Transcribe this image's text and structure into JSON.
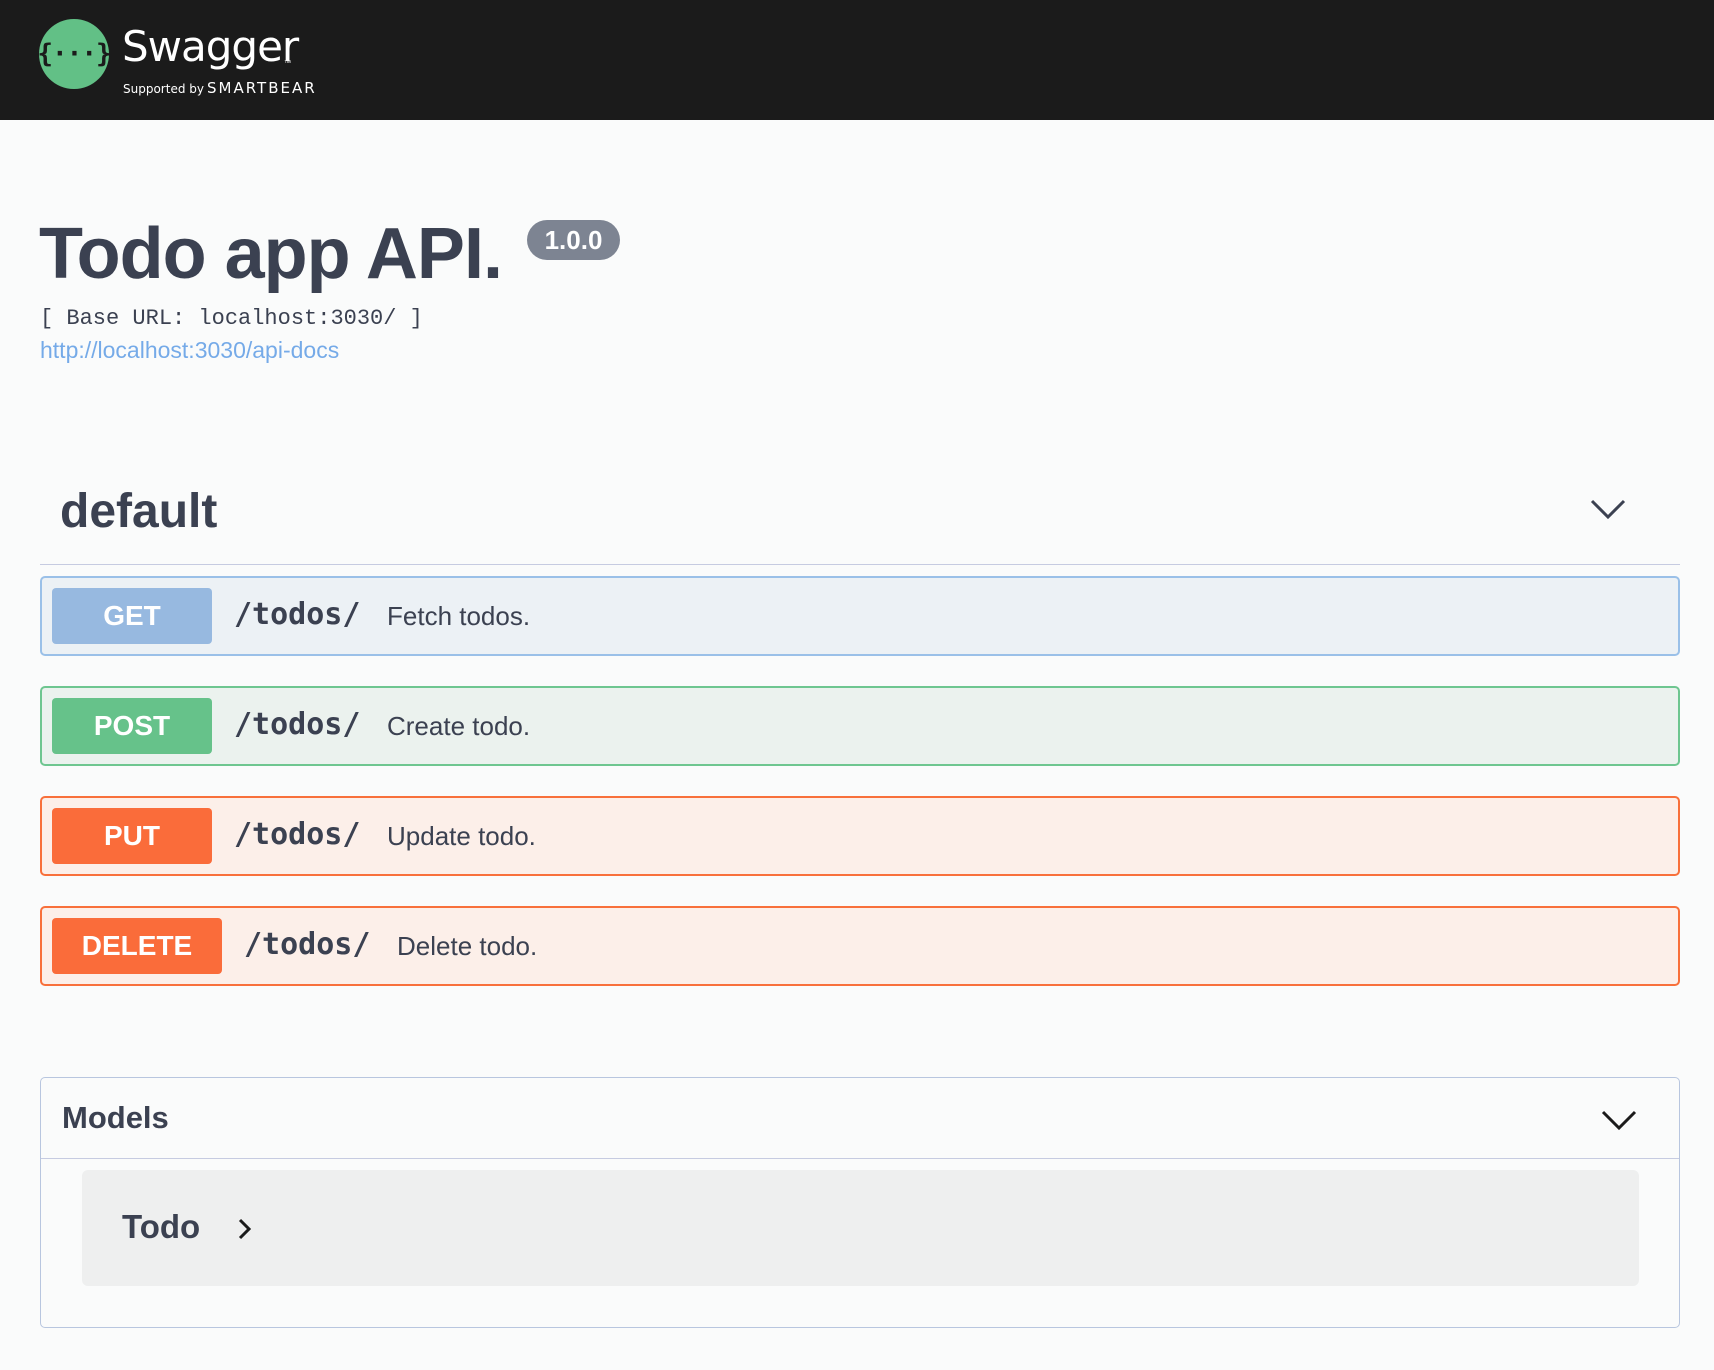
{
  "header": {
    "logo_icon": "swagger-braces-icon",
    "logo_glyph": "{···}",
    "brand": "Swagger",
    "trademark": "™",
    "supported_by": "Supported by",
    "company": "SMARTBEAR"
  },
  "info": {
    "title": "Todo app API.",
    "version": "1.0.0",
    "base_url": "[ Base URL: localhost:3030/ ]",
    "docs_link": "http://localhost:3030/api-docs"
  },
  "tag": {
    "name": "default",
    "chevron_icon": "chevron-down-icon",
    "operations": [
      {
        "method": "GET",
        "path": "/todos/",
        "summary": "Fetch todos."
      },
      {
        "method": "POST",
        "path": "/todos/",
        "summary": "Create todo."
      },
      {
        "method": "PUT",
        "path": "/todos/",
        "summary": "Update todo."
      },
      {
        "method": "DELETE",
        "path": "/todos/",
        "summary": "Delete todo."
      }
    ]
  },
  "models": {
    "title": "Models",
    "chevron_icon": "chevron-down-icon",
    "items": [
      {
        "name": "Todo",
        "icon": "chevron-right-icon"
      }
    ]
  },
  "colors": {
    "topbar": "#1b1b1b",
    "logo": "#62c086",
    "get": "#97b9e0",
    "post": "#66c28a",
    "put": "#fa6c3a",
    "delete": "#fa6c3a"
  }
}
